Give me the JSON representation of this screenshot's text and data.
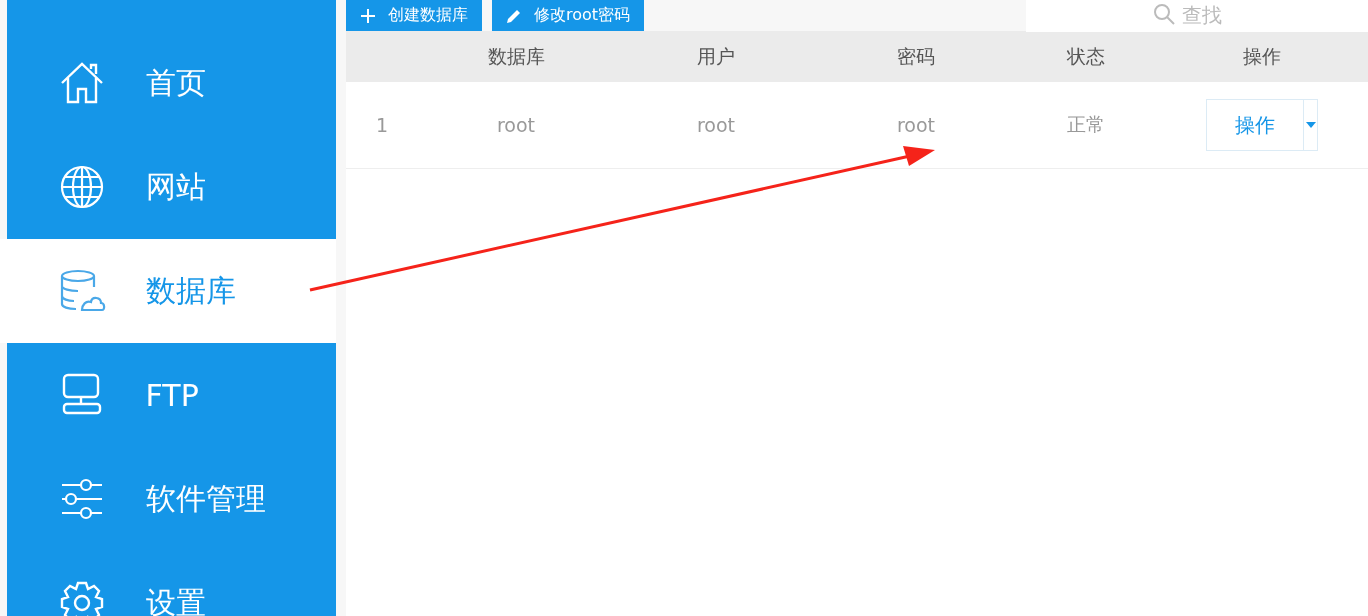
{
  "sidebar": {
    "items": [
      {
        "label": "首页",
        "kind": "home",
        "selected": false
      },
      {
        "label": "网站",
        "kind": "globe",
        "selected": false
      },
      {
        "label": "数据库",
        "kind": "database",
        "selected": true
      },
      {
        "label": "FTP",
        "kind": "server",
        "selected": false
      },
      {
        "label": "软件管理",
        "kind": "sliders",
        "selected": false
      },
      {
        "label": "设置",
        "kind": "gear",
        "selected": false
      }
    ]
  },
  "toolbar": {
    "buttons": [
      {
        "label": "创建数据库",
        "kind": "plus"
      },
      {
        "label": "修改root密码",
        "kind": "pencil"
      }
    ],
    "search": {
      "placeholder": "查找"
    }
  },
  "table": {
    "columns": [
      "",
      "数据库",
      "用户",
      "密码",
      "状态",
      "操作"
    ],
    "rows": [
      {
        "index": "1",
        "database": "root",
        "user": "root",
        "password": "root",
        "status": "正常",
        "action": "操作"
      }
    ]
  },
  "annotation": {
    "kind": "arrow"
  }
}
